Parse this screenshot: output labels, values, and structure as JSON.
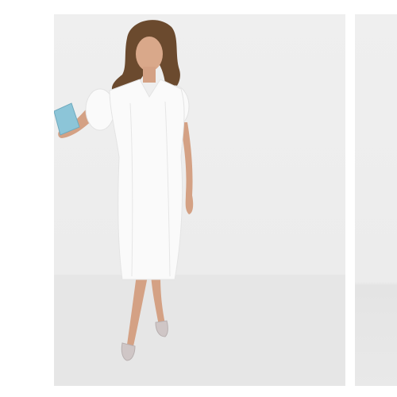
{
  "product": {
    "image_subject": "model-in-white-midi-dress",
    "wishlist": {
      "icon": "heart-outline-icon",
      "saved": false
    }
  },
  "colors": {
    "card_background": "#ececec",
    "dress": "#fafafa",
    "heart_stroke": "#222222"
  }
}
